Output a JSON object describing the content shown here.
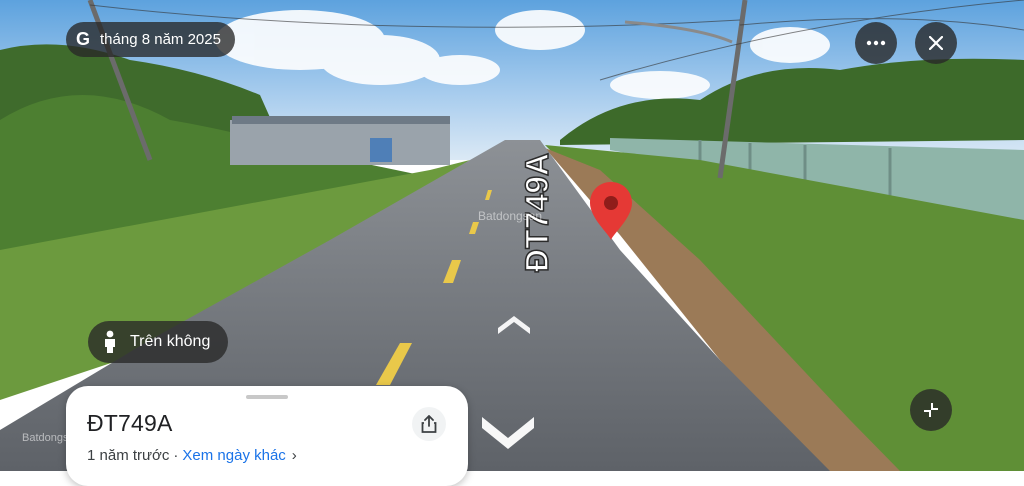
{
  "streetview": {
    "date_label": "tháng 8 năm 2025",
    "road_marking": "ĐT749A",
    "mode_label": "Trên không",
    "watermark": "Batdongsan"
  },
  "card": {
    "title": "ĐT749A",
    "age_label": "1 năm trước",
    "separator": "·",
    "other_dates_link": "Xem ngày khác",
    "chevron": "›"
  },
  "icons": {
    "google": "G",
    "more": "more-horizontal-icon",
    "close": "close-icon",
    "pegman": "pegman-icon",
    "collapse": "collapse-icon",
    "share": "share-icon",
    "nav_up": "chevron-up-icon",
    "nav_down": "chevron-down-icon",
    "pin": "location-pin-icon"
  },
  "colors": {
    "pin": "#e53935",
    "link": "#1a73e8",
    "chip_bg": "#282828"
  }
}
